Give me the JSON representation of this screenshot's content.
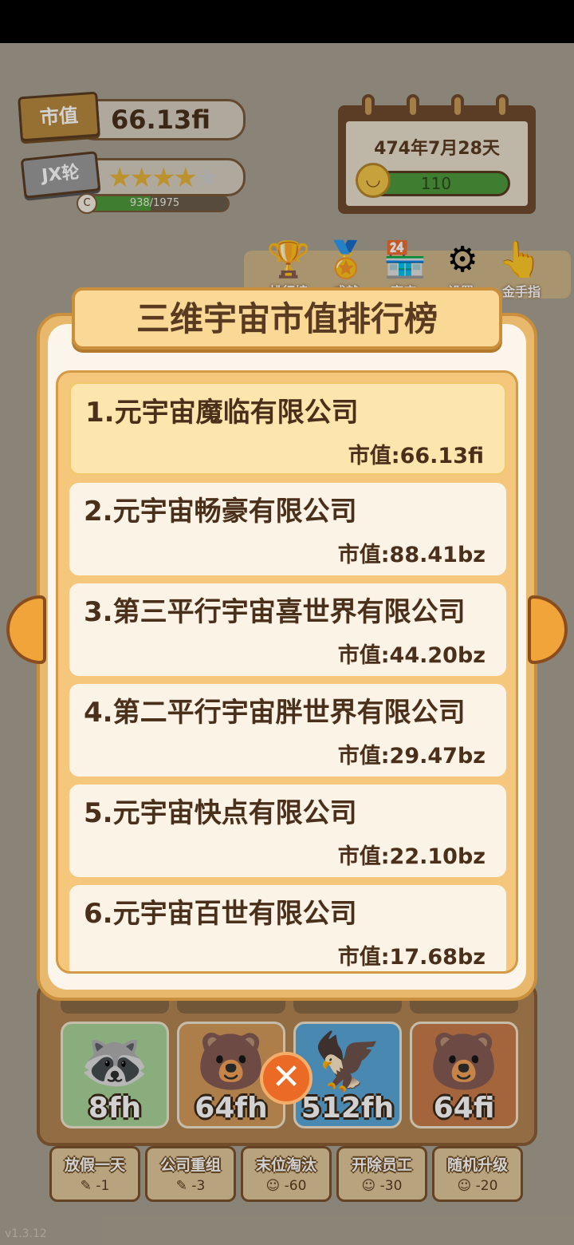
{
  "hud": {
    "market_value_label": "市值",
    "market_value": "66.13fi",
    "rank_label": "JX轮",
    "stars_filled": 4,
    "stars_total": 5,
    "xp_badge": "C",
    "xp_text": "938/1975",
    "xp_current": 938,
    "xp_max": 1975
  },
  "calendar": {
    "date": "474年7月28天",
    "mood_value": "110"
  },
  "menu": {
    "items": [
      {
        "icon": "trophy-icon",
        "label": "排行榜"
      },
      {
        "icon": "medal-icon",
        "label": "成就"
      },
      {
        "icon": "shop-icon",
        "label": "商店"
      },
      {
        "icon": "gear-icon",
        "label": "设置"
      },
      {
        "icon": "hand-icon",
        "label": "金手指"
      }
    ]
  },
  "modal": {
    "title": "三维宇宙市值排行榜",
    "rows": [
      {
        "name": "1.元宇宙魔临有限公司",
        "value": "市值:66.13fi"
      },
      {
        "name": "2.元宇宙畅豪有限公司",
        "value": "市值:88.41bz"
      },
      {
        "name": "3.第三平行宇宙喜世界有限公司",
        "value": "市值:44.20bz"
      },
      {
        "name": "4.第二平行宇宙胖世界有限公司",
        "value": "市值:29.47bz"
      },
      {
        "name": "5.元宇宙快点有限公司",
        "value": "市值:22.10bz"
      },
      {
        "name": "6.元宇宙百世有限公司",
        "value": "市值:17.68bz"
      }
    ],
    "close": "✕"
  },
  "cards": [
    {
      "label": "8fh",
      "color": "#a9d49a",
      "char": "🦝"
    },
    {
      "label": "64fh",
      "color": "#d49a5a",
      "char": "🐻"
    },
    {
      "label": "512fh",
      "color": "#5aa8d8",
      "char": "🦅"
    },
    {
      "label": "64fi",
      "color": "#c97a4a",
      "char": "🐻"
    }
  ],
  "actions": [
    {
      "label": "放假一天",
      "cost": "-1"
    },
    {
      "label": "公司重组",
      "cost": "-3"
    },
    {
      "label": "末位淘汰",
      "cost": "-60"
    },
    {
      "label": "开除员工",
      "cost": "-30"
    },
    {
      "label": "随机升级",
      "cost": "-20"
    }
  ],
  "version": "v1.3.12"
}
